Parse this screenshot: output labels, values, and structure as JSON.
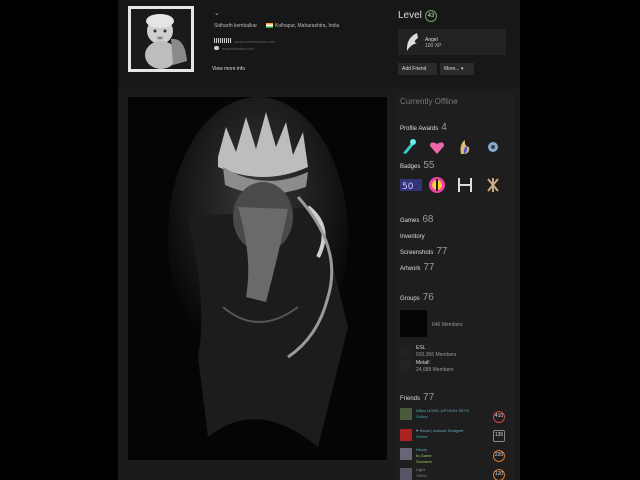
{
  "colors": {
    "background": "#000000",
    "panel": "#1b1b1b",
    "accent_level": "#66aa66"
  },
  "profile": {
    "dropdown_icon": "chevron-down-icon",
    "real_name": "Sidharth kembalkar",
    "location": "Kolhapur, Maharashtra, India",
    "link1": "www.overthrowkin.com",
    "link2": "www.linkedin.com",
    "view_more": "View more info"
  },
  "level": {
    "label": "Level",
    "value": "43"
  },
  "xp": {
    "name": "Angel",
    "value": "100 XP"
  },
  "buttons": {
    "add_friend": "Add Friend",
    "more": "More..."
  },
  "sidebar": {
    "status": "Currently Offline",
    "awards": {
      "label": "Profile Awards",
      "count": "4"
    },
    "badges": {
      "label": "Badges",
      "count": "55"
    },
    "games": {
      "label": "Games",
      "count": "68"
    },
    "inventory": {
      "label": "Inventory"
    },
    "screenshots": {
      "label": "Screenshots",
      "count": "77"
    },
    "artwork": {
      "label": "Artwork",
      "count": "77"
    },
    "groups": {
      "label": "Groups",
      "count": "76",
      "items": [
        {
          "name": "",
          "members": "646 Members"
        },
        {
          "name": "ESL",
          "members": "600,356 Members"
        },
        {
          "name": "Metal!",
          "members": "24,688 Members"
        }
      ]
    },
    "friends": {
      "label": "Friends",
      "count": "77",
      "items": [
        {
          "name": "Wilco LEVEL-UP HIGH SETS",
          "status": "Online",
          "level": "410"
        },
        {
          "name": "♥ Rahul | Artwork Designer",
          "status": "Online",
          "level": "135"
        },
        {
          "name": "Nezzy",
          "status": "In-Game",
          "status2": "Scenario",
          "level": "220"
        },
        {
          "name": "Light",
          "status": "Offline",
          "level": "120"
        }
      ]
    }
  }
}
